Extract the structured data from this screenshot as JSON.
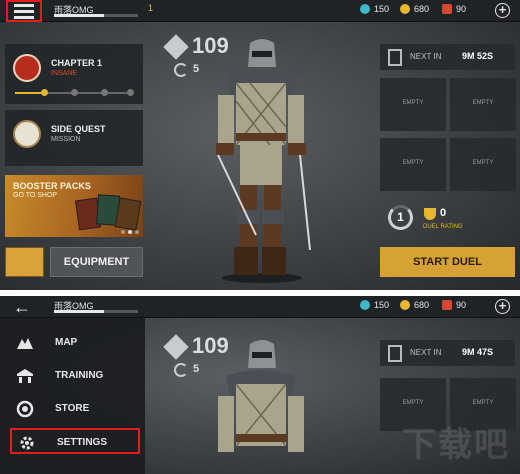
{
  "colors": {
    "accent": "#e6b830",
    "highlight": "#e01e1e",
    "insane": "#d9462e",
    "start_button": "#d6a135"
  },
  "top_screen": {
    "header": {
      "player_name": "雨落OMG",
      "level": "1",
      "xp_progress": 0.6,
      "currencies": [
        {
          "icon": "gems-icon",
          "value": "150"
        },
        {
          "icon": "coins-icon",
          "value": "680"
        },
        {
          "icon": "ruby-icon",
          "value": "90"
        }
      ]
    },
    "chapter": {
      "title": "CHAPTER 1",
      "difficulty": "INSANE"
    },
    "side_quest": {
      "title": "SIDE QUEST",
      "subtitle": "MISSION"
    },
    "booster": {
      "title": "BOOSTER PACKS",
      "subtitle": "GO TO SHOP"
    },
    "equipment_label": "EQUIPMENT",
    "power": "109",
    "refresh_count": "5",
    "next_in": {
      "label": "NEXT IN",
      "time": "9M 52S"
    },
    "slots": [
      "EMPTY",
      "EMPTY",
      "EMPTY",
      "EMPTY"
    ],
    "duel": {
      "rank": "1",
      "rating": "0",
      "rating_label": "DUEL RATING"
    },
    "start_duel_label": "START DUEL"
  },
  "bottom_screen": {
    "header": {
      "player_name": "雨落OMG",
      "xp_progress": 0.6,
      "currencies": [
        {
          "icon": "gems-icon",
          "value": "150"
        },
        {
          "icon": "coins-icon",
          "value": "680"
        },
        {
          "icon": "ruby-icon",
          "value": "90"
        }
      ]
    },
    "menu": [
      {
        "icon": "map-icon",
        "label": "MAP"
      },
      {
        "icon": "training-icon",
        "label": "TRAINING"
      },
      {
        "icon": "store-icon",
        "label": "STORE"
      },
      {
        "icon": "settings-gear-icon",
        "label": "SETTINGS",
        "selected": true
      }
    ],
    "power": "109",
    "refresh_count": "5",
    "next_in": {
      "label": "NEXT IN",
      "time": "9M 47S"
    },
    "slots": [
      "EMPTY",
      "EMPTY"
    ]
  },
  "watermark": "下载吧"
}
